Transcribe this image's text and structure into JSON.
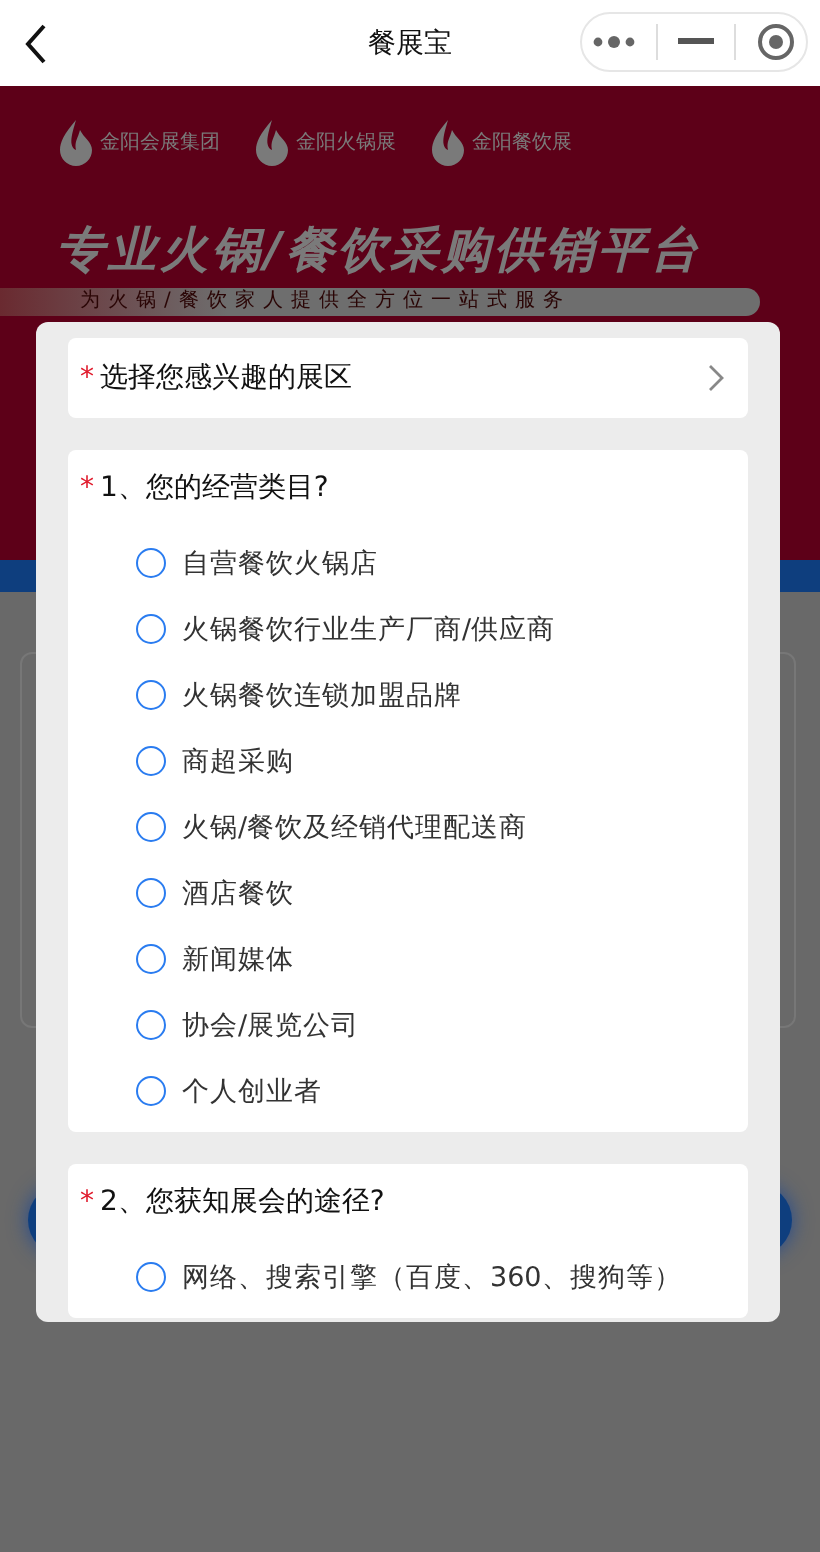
{
  "nav": {
    "title": "餐展宝"
  },
  "banner": {
    "logos": [
      "金阳会展集团",
      "金阳火锅展",
      "金阳餐饮展"
    ],
    "title": "专业火锅/餐饮采购供销平台",
    "subtitle": "为火锅/餐饮家人提供全方位一站式服务"
  },
  "modal": {
    "area_picker": {
      "required_mark": "*",
      "label": "选择您感兴趣的展区"
    },
    "questions": [
      {
        "required_mark": "*",
        "title": "1、您的经营类目?",
        "options": [
          {
            "label": "自营餐饮火锅店",
            "selected": false
          },
          {
            "label": "火锅餐饮行业生产厂商/供应商",
            "selected": false
          },
          {
            "label": "火锅餐饮连锁加盟品牌",
            "selected": false
          },
          {
            "label": "商超采购",
            "selected": false
          },
          {
            "label": "火锅/餐饮及经销代理配送商",
            "selected": false
          },
          {
            "label": "酒店餐饮",
            "selected": false
          },
          {
            "label": "新闻媒体",
            "selected": false
          },
          {
            "label": "协会/展览公司",
            "selected": false
          },
          {
            "label": "个人创业者",
            "selected": false
          }
        ]
      },
      {
        "required_mark": "*",
        "title": "2、您获知展会的途径?",
        "options": [
          {
            "label": "网络、搜索引擎（百度、360、搜狗等）",
            "selected": false
          }
        ]
      }
    ]
  }
}
